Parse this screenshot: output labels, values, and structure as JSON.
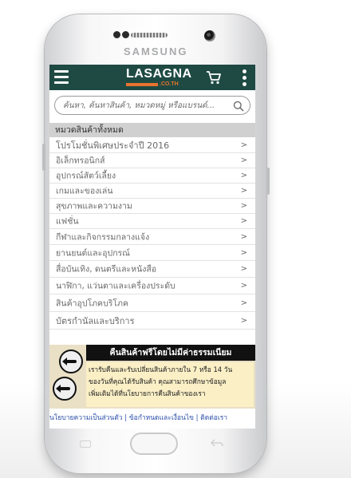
{
  "device": {
    "brand": "SAMSUNG"
  },
  "topbar": {
    "logo_main": "LASAGNA",
    "logo_sub": ".CO.TH",
    "colors": {
      "bar": "#1e4a43",
      "accent": "#e8732e"
    }
  },
  "search": {
    "placeholder": "ค้นหา, ค้นหาสินค้า, หมวดหมู่ หรือแบรนด์..."
  },
  "categories": {
    "header": "หมวดสินค้าทั้งหมด",
    "chevron": ">",
    "items": [
      {
        "label": "โปรโมชั่นพิเศษประจำปี 2016"
      },
      {
        "label": "อิเล็กทรอนิกส์"
      },
      {
        "label": "อุปกรณ์สัตว์เลี้ยง"
      },
      {
        "label": "เกมและของเล่น"
      },
      {
        "label": "สุขภาพและความงาม"
      },
      {
        "label": "แฟชั่น"
      },
      {
        "label": "กีฬาและกิจกรรมกลางแจ้ง"
      },
      {
        "label": "ยานยนต์และอุปกรณ์"
      },
      {
        "label": "สื่อบันเทิง, ดนตรีและหนังสือ"
      },
      {
        "label": "นาฬิกา, แว่นตาและเครื่องประดับ"
      },
      {
        "label": "สินค้าอุปโภคบริโภค"
      },
      {
        "label": "บัตรกำนัลและบริการ"
      }
    ]
  },
  "banner": {
    "title": "คืนสินค้าฟรีโดยไม่มีค่าธรรมเนียม",
    "line1": "เรารับคืนและรับเปลี่ยนสินค้าภายใน 7 หรือ 14 วัน",
    "line2": "ของวันที่คุณได้รับสินค้า คุณสามารถศึกษาข้อมูล",
    "line3": "เพิ่มเติมได้ที่นโยบายการคืนสินค้าของเรา"
  },
  "footer": {
    "privacy": "นโยบายความเป็นส่วนตัว",
    "terms": "ข้อกำหนดและเงื่อนไข",
    "contact": "ติดต่อเรา",
    "separator": "|"
  }
}
